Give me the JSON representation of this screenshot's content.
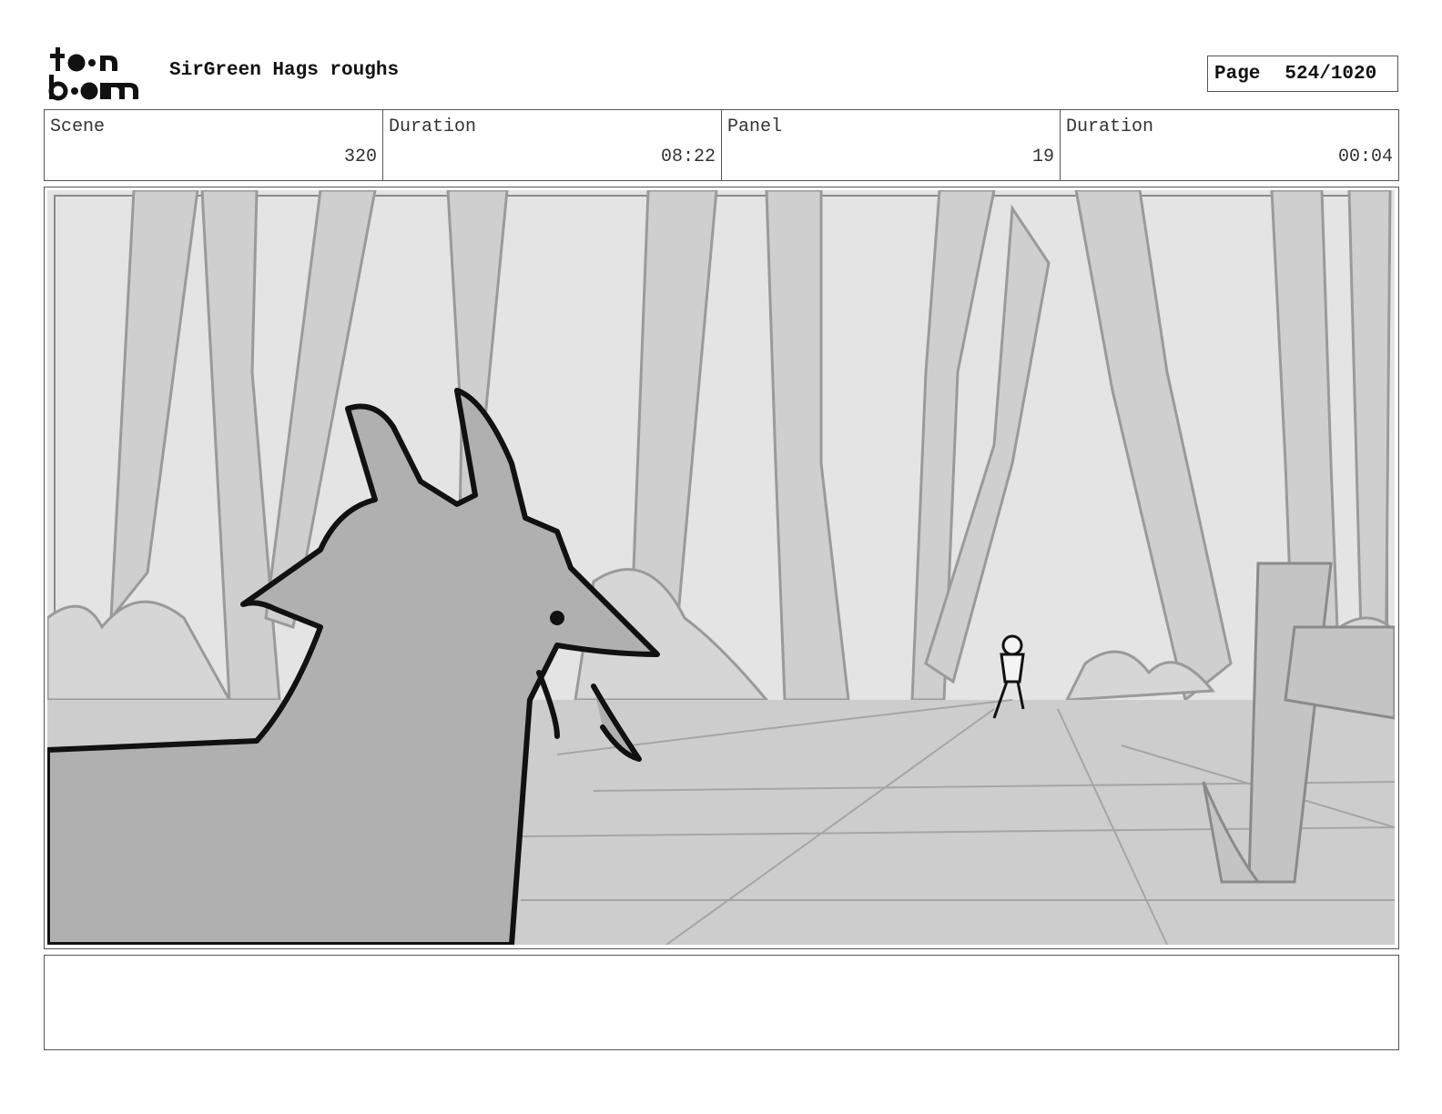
{
  "header": {
    "logo_lines": [
      "toon",
      "boom"
    ],
    "project_title": "SirGreen Hags roughs",
    "page_label": "Page",
    "page_value": "524/1020"
  },
  "info": {
    "scene": {
      "label": "Scene",
      "value": "320"
    },
    "scene_duration": {
      "label": "Duration",
      "value": "08:22"
    },
    "panel": {
      "label": "Panel",
      "value": "19"
    },
    "panel_duration": {
      "label": "Duration",
      "value": "00:04"
    }
  },
  "panel_image": {
    "icon": "storyboard-sketch",
    "description_icons": [
      "goat-head",
      "forest-trees",
      "walking-figure",
      "fence-post"
    ]
  },
  "notes": {
    "text": ""
  }
}
